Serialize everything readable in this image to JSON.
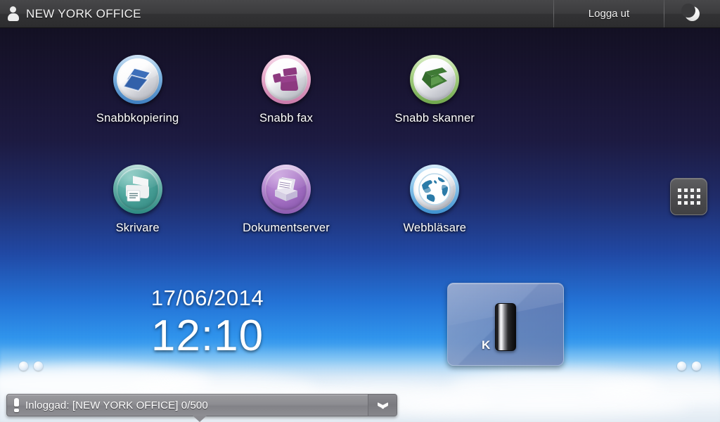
{
  "topbar": {
    "user_icon": "user-icon",
    "user_name": "NEW YORK OFFICE",
    "logout_label": "Logga ut",
    "sleep_icon": "moon-icon"
  },
  "apps": [
    {
      "id": "quick-copy",
      "label": "Snabbkopiering",
      "icon": "copy-icon",
      "ring": "ring-blue",
      "accent": "#3f6fb5"
    },
    {
      "id": "quick-fax",
      "label": "Snabb fax",
      "icon": "fax-icon",
      "ring": "ring-pink",
      "accent": "#8e3d80"
    },
    {
      "id": "quick-scanner",
      "label": "Snabb skanner",
      "icon": "scanner-icon",
      "ring": "ring-green",
      "accent": "#3f7a35"
    },
    {
      "id": "printer",
      "label": "Skrivare",
      "icon": "printer-icon",
      "ring": "ring-teal",
      "accent": "#2e8b82"
    },
    {
      "id": "document-server",
      "label": "Dokumentserver",
      "icon": "document-server-icon",
      "ring": "ring-purple",
      "accent": "#8d5cb0"
    },
    {
      "id": "web-browser",
      "label": "Webbläsare",
      "icon": "globe-icon",
      "ring": "ring-lblue",
      "accent": "#2c7fb8"
    }
  ],
  "drawer": {
    "icon": "app-grid-icon",
    "rows": 3,
    "cols": 4
  },
  "clock": {
    "date": "17/06/2014",
    "time": "12:10"
  },
  "toner_widget": {
    "icon": "toner-cartridge-icon",
    "color_label": "K",
    "level_percent": 100
  },
  "page_dots": {
    "left_count": 2,
    "right_count": 2
  },
  "statusbar": {
    "alert_icon": "exclamation-icon",
    "message": "Inloggad: [NEW YORK OFFICE] 0/500",
    "expand_icon": "chevron-down-icon"
  },
  "colors": {
    "topbar_bg": "#3a3a3c",
    "sky_top": "#0d0b1b",
    "sky_mid": "#2272d6",
    "cloud": "#e8eef4",
    "statusbar_bg": "#8d8d92"
  }
}
